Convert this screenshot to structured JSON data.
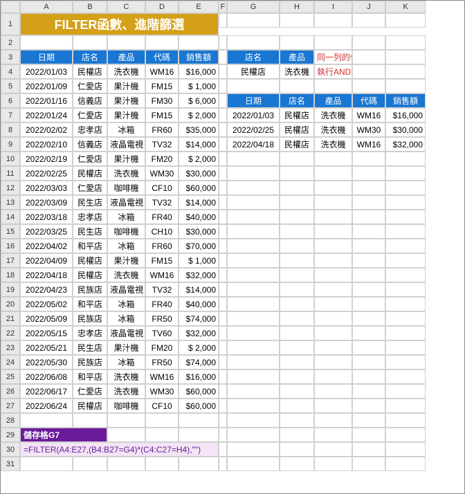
{
  "cols": [
    "",
    "A",
    "B",
    "C",
    "D",
    "E",
    "F",
    "G",
    "H",
    "I",
    "J",
    "K"
  ],
  "title": "FILTER函數、進階篩選",
  "headers1": [
    "日期",
    "店名",
    "產品",
    "代碼",
    "銷售額"
  ],
  "headers2a": [
    "店名",
    "產品"
  ],
  "headers2b": [
    "日期",
    "店名",
    "產品",
    "代碼",
    "銷售額"
  ],
  "note1": "同一列的條件",
  "note2": "執行AND運算",
  "criteria": [
    "民權店",
    "洗衣機"
  ],
  "main": [
    [
      "2022/01/03",
      "民權店",
      "洗衣機",
      "WM16",
      "$16,000"
    ],
    [
      "2022/01/09",
      "仁愛店",
      "果汁機",
      "FM15",
      "$  1,000"
    ],
    [
      "2022/01/16",
      "信義店",
      "果汁機",
      "FM30",
      "$  6,000"
    ],
    [
      "2022/01/24",
      "仁愛店",
      "果汁機",
      "FM15",
      "$  2,000"
    ],
    [
      "2022/02/02",
      "忠孝店",
      "冰箱",
      "FR60",
      "$35,000"
    ],
    [
      "2022/02/10",
      "信義店",
      "液晶電視",
      "TV32",
      "$14,000"
    ],
    [
      "2022/02/19",
      "仁愛店",
      "果汁機",
      "FM20",
      "$  2,000"
    ],
    [
      "2022/02/25",
      "民權店",
      "洗衣機",
      "WM30",
      "$30,000"
    ],
    [
      "2022/03/03",
      "仁愛店",
      "咖啡機",
      "CF10",
      "$60,000"
    ],
    [
      "2022/03/09",
      "民生店",
      "液晶電視",
      "TV32",
      "$14,000"
    ],
    [
      "2022/03/18",
      "忠孝店",
      "冰箱",
      "FR40",
      "$40,000"
    ],
    [
      "2022/03/25",
      "民生店",
      "咖啡機",
      "CH10",
      "$30,000"
    ],
    [
      "2022/04/02",
      "和平店",
      "冰箱",
      "FR60",
      "$70,000"
    ],
    [
      "2022/04/09",
      "民權店",
      "果汁機",
      "FM15",
      "$  1,000"
    ],
    [
      "2022/04/18",
      "民權店",
      "洗衣機",
      "WM16",
      "$32,000"
    ],
    [
      "2022/04/23",
      "民族店",
      "液晶電視",
      "TV32",
      "$14,000"
    ],
    [
      "2022/05/02",
      "和平店",
      "冰箱",
      "FR40",
      "$40,000"
    ],
    [
      "2022/05/09",
      "民族店",
      "冰箱",
      "FR50",
      "$74,000"
    ],
    [
      "2022/05/15",
      "忠孝店",
      "液晶電視",
      "TV60",
      "$32,000"
    ],
    [
      "2022/05/21",
      "民生店",
      "果汁機",
      "FM20",
      "$  2,000"
    ],
    [
      "2022/05/30",
      "民族店",
      "冰箱",
      "FR50",
      "$74,000"
    ],
    [
      "2022/06/08",
      "和平店",
      "洗衣機",
      "WM16",
      "$16,000"
    ],
    [
      "2022/06/17",
      "仁愛店",
      "洗衣機",
      "WM30",
      "$60,000"
    ],
    [
      "2022/06/24",
      "民權店",
      "咖啡機",
      "CF10",
      "$60,000"
    ]
  ],
  "result": [
    [
      "2022/01/03",
      "民權店",
      "洗衣機",
      "WM16",
      "$16,000"
    ],
    [
      "2022/02/25",
      "民權店",
      "洗衣機",
      "WM30",
      "$30,000"
    ],
    [
      "2022/04/18",
      "民權店",
      "洗衣機",
      "WM16",
      "$32,000"
    ]
  ],
  "cellref": "儲存格G7",
  "formula": "=FILTER(A4:E27,(B4:B27=G4)*(C4:C27=H4),\"\")"
}
